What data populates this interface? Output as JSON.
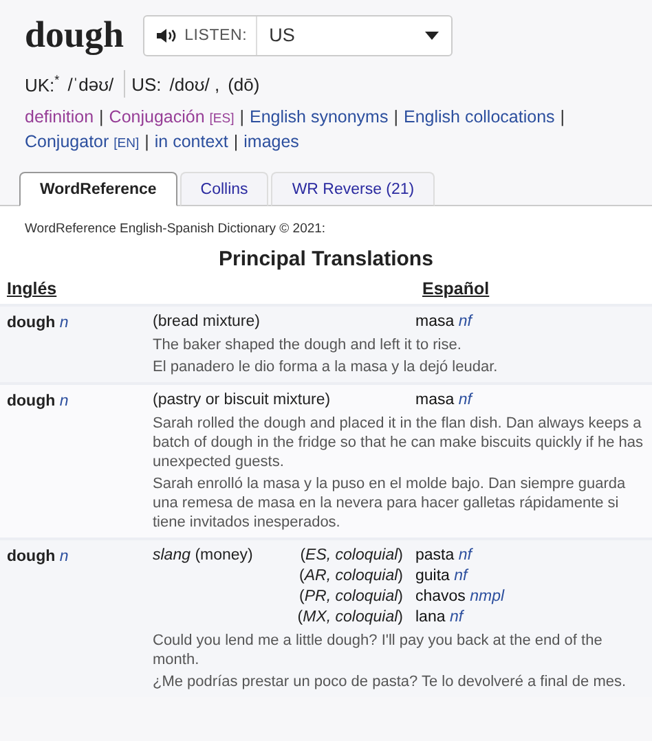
{
  "headword": "dough",
  "listen": {
    "label": "LISTEN:",
    "dialect": "US"
  },
  "pronunciation": {
    "uk_label": "UK:",
    "uk_mark": "*",
    "uk_ipa": "/ˈdəʊ/",
    "us_label": "US:",
    "us_ipa": "/doʊ/ ,",
    "us_respelling": "(dō)"
  },
  "separator": "|",
  "link_lines": [
    [
      {
        "text": "definition",
        "visited": true
      },
      {
        "text": "Conjugación",
        "tag": "[ES]",
        "visited": true
      },
      {
        "text": "English synonyms",
        "visited": false
      },
      {
        "text": "English collocations",
        "visited": false
      }
    ],
    [
      {
        "text": "Conjugator",
        "tag": "[EN]",
        "visited": false
      },
      {
        "text": "in context",
        "visited": false
      },
      {
        "text": "images",
        "visited": false
      }
    ]
  ],
  "tabs": [
    {
      "label": "WordReference",
      "selected": true
    },
    {
      "label": "Collins",
      "selected": false
    },
    {
      "label": "WR Reverse (21)",
      "selected": false
    }
  ],
  "source": "WordReference English-Spanish Dictionary © 2021:",
  "section_title": "Principal Translations",
  "columns": [
    "Inglés",
    "Español"
  ],
  "entries": [
    {
      "term": "dough",
      "pos": "n",
      "sense": "(bread mixture)",
      "translations": [
        {
          "word": "masa",
          "pos": "nf"
        }
      ],
      "examples": [
        "The baker shaped the dough and left it to rise.",
        "El panadero le dio forma a la masa y la dejó leudar."
      ]
    },
    {
      "term": "dough",
      "pos": "n",
      "sense": "(pastry or biscuit mixture)",
      "translations": [
        {
          "word": "masa",
          "pos": "nf"
        }
      ],
      "examples": [
        "Sarah rolled the dough and placed it in the flan dish. Dan always keeps a batch of dough in the fridge so that he can make biscuits quickly if he has unexpected guests.",
        "Sarah enrolló la masa y la puso en el molde bajo. Dan siempre guarda una remesa de masa en la nevera para hacer galletas rápidamente si tiene invitados inesperados."
      ]
    },
    {
      "term": "dough",
      "pos": "n",
      "sense": "*slang* (money)",
      "translations": [
        {
          "note": "(*ES, coloquial*)",
          "word": "pasta",
          "pos": "nf"
        },
        {
          "note": "(*AR, coloquial*)",
          "word": "guita",
          "pos": "nf"
        },
        {
          "note": "(*PR, coloquial*)",
          "word": "chavos",
          "pos": "nmpl"
        },
        {
          "note": "(*MX, coloquial*)",
          "word": "lana",
          "pos": "nf"
        }
      ],
      "examples": [
        "Could you lend me a little dough? I'll pay you back at the end of the month.",
        "¿Me podrías prestar un poco de pasta? Te lo devolveré a final de mes."
      ]
    }
  ]
}
